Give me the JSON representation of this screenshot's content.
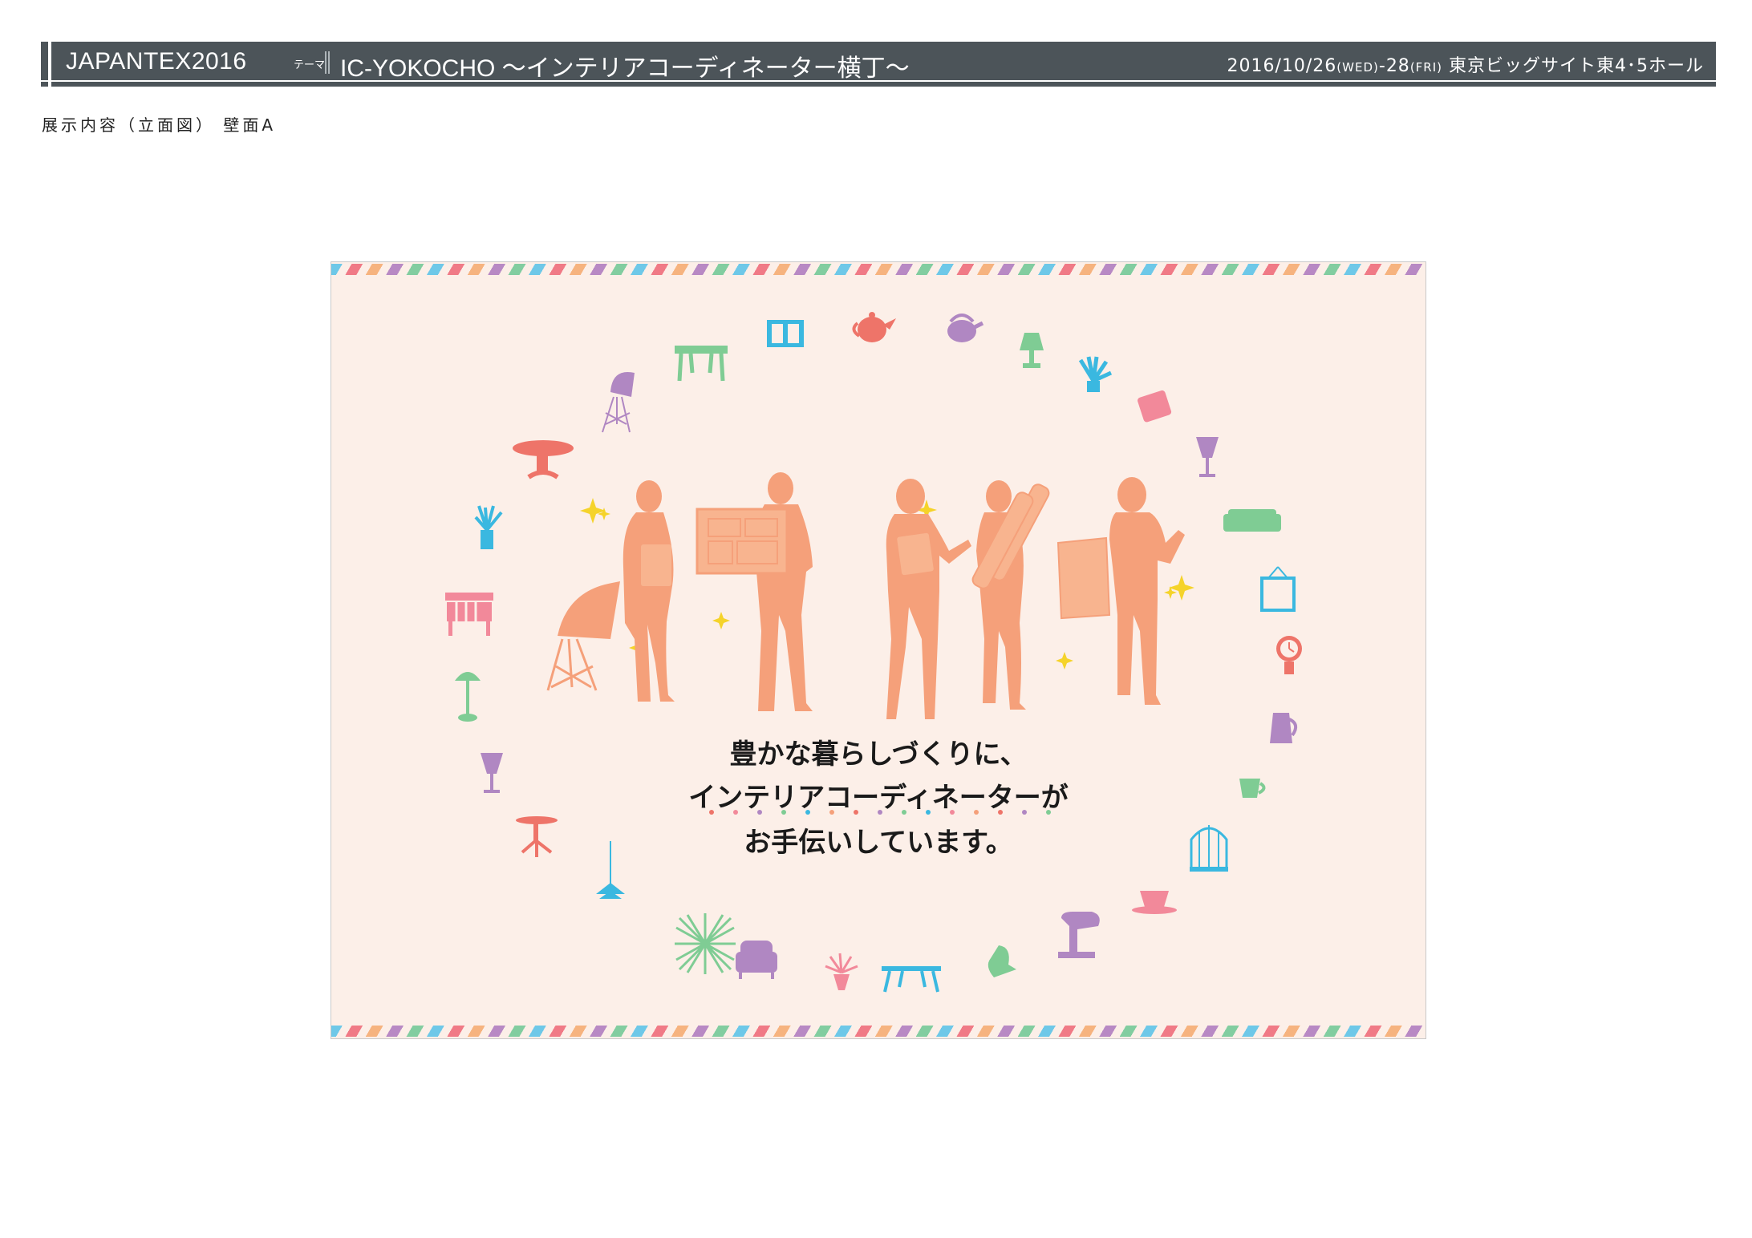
{
  "header": {
    "event": "JAPANTEX2016",
    "theme_label": "テーマ",
    "theme": "IC-YOKOCHO ～インテリアコーディネーター横丁～",
    "date_main": "2016/10/26",
    "date_wed": "(WED)",
    "date_sep": "-28",
    "date_fri": "(FRI)",
    "venue": "東京ビッグサイト東4･5ホール"
  },
  "subtitle": "展示内容（立面図） 壁面A",
  "panel": {
    "message_line1": "豊かな暮らしづくりに、",
    "message_line2": "インテリアコーディネーターが",
    "message_line3": "お手伝いしています。"
  },
  "colors": {
    "header_bg": "#4c5459",
    "panel_bg": "#fcefe8",
    "people": "#f5a07a",
    "blue": "#3ab8e0",
    "red": "#ee7469",
    "purple": "#b087c2",
    "green": "#7fcc94",
    "pink": "#f2899a",
    "yellow": "#f5d32a"
  },
  "icons": [
    "window-icon",
    "teapot-icon",
    "kettle-icon",
    "lamp-icon",
    "plant-icon",
    "cushion-icon",
    "wine-glass-icon",
    "sofa-icon",
    "frame-icon",
    "clock-icon",
    "coffee-pot-icon",
    "cup-icon",
    "birdcage-icon",
    "teacup-icon",
    "mixer-icon",
    "chair-icon",
    "table-icon",
    "pendant-lamp-icon",
    "starburst-icon",
    "armchair-icon",
    "shell-chair-icon",
    "side-table-icon",
    "dresser-icon"
  ]
}
